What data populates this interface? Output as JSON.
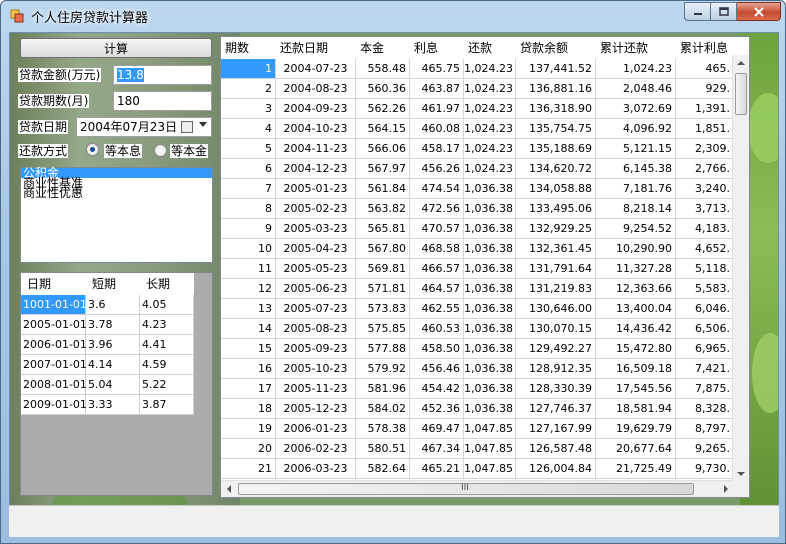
{
  "window": {
    "title": "个人住房贷款计算器"
  },
  "form": {
    "calc_label": "计算",
    "amount_label": "贷款金额(万元)",
    "amount_value": "13.8",
    "term_label": "贷款期数(月)",
    "term_value": "180",
    "date_label": "贷款日期",
    "date_value": "2004年07月23日",
    "method_label": "还款方式",
    "method_options": [
      "等本息",
      "等本金"
    ],
    "method_selected": "等本息"
  },
  "loan_types": [
    "公积金",
    "商业性基准",
    "商业性优惠"
  ],
  "rate_table": {
    "headers": [
      "日期",
      "短期",
      "长期"
    ],
    "rows": [
      [
        "1001-01-01",
        "3.6",
        "4.05"
      ],
      [
        "2005-01-01",
        "3.78",
        "4.23"
      ],
      [
        "2006-01-01",
        "3.96",
        "4.41"
      ],
      [
        "2007-01-01",
        "4.14",
        "4.59"
      ],
      [
        "2008-01-01",
        "5.04",
        "5.22"
      ],
      [
        "2009-01-01",
        "3.33",
        "3.87"
      ]
    ]
  },
  "schedule": {
    "headers": [
      "期数",
      "还款日期",
      "本金",
      "利息",
      "还款",
      "贷款余额",
      "累计还款",
      "累计利息"
    ],
    "rows": [
      [
        "1",
        "2004-07-23",
        "558.48",
        "465.75",
        "1,024.23",
        "137,441.52",
        "1,024.23",
        "465."
      ],
      [
        "2",
        "2004-08-23",
        "560.36",
        "463.87",
        "1,024.23",
        "136,881.16",
        "2,048.46",
        "929."
      ],
      [
        "3",
        "2004-09-23",
        "562.26",
        "461.97",
        "1,024.23",
        "136,318.90",
        "3,072.69",
        "1,391."
      ],
      [
        "4",
        "2004-10-23",
        "564.15",
        "460.08",
        "1,024.23",
        "135,754.75",
        "4,096.92",
        "1,851."
      ],
      [
        "5",
        "2004-11-23",
        "566.06",
        "458.17",
        "1,024.23",
        "135,188.69",
        "5,121.15",
        "2,309."
      ],
      [
        "6",
        "2004-12-23",
        "567.97",
        "456.26",
        "1,024.23",
        "134,620.72",
        "6,145.38",
        "2,766."
      ],
      [
        "7",
        "2005-01-23",
        "561.84",
        "474.54",
        "1,036.38",
        "134,058.88",
        "7,181.76",
        "3,240."
      ],
      [
        "8",
        "2005-02-23",
        "563.82",
        "472.56",
        "1,036.38",
        "133,495.06",
        "8,218.14",
        "3,713."
      ],
      [
        "9",
        "2005-03-23",
        "565.81",
        "470.57",
        "1,036.38",
        "132,929.25",
        "9,254.52",
        "4,183."
      ],
      [
        "10",
        "2005-04-23",
        "567.80",
        "468.58",
        "1,036.38",
        "132,361.45",
        "10,290.90",
        "4,652."
      ],
      [
        "11",
        "2005-05-23",
        "569.81",
        "466.57",
        "1,036.38",
        "131,791.64",
        "11,327.28",
        "5,118."
      ],
      [
        "12",
        "2005-06-23",
        "571.81",
        "464.57",
        "1,036.38",
        "131,219.83",
        "12,363.66",
        "5,583."
      ],
      [
        "13",
        "2005-07-23",
        "573.83",
        "462.55",
        "1,036.38",
        "130,646.00",
        "13,400.04",
        "6,046."
      ],
      [
        "14",
        "2005-08-23",
        "575.85",
        "460.53",
        "1,036.38",
        "130,070.15",
        "14,436.42",
        "6,506."
      ],
      [
        "15",
        "2005-09-23",
        "577.88",
        "458.50",
        "1,036.38",
        "129,492.27",
        "15,472.80",
        "6,965."
      ],
      [
        "16",
        "2005-10-23",
        "579.92",
        "456.46",
        "1,036.38",
        "128,912.35",
        "16,509.18",
        "7,421."
      ],
      [
        "17",
        "2005-11-23",
        "581.96",
        "454.42",
        "1,036.38",
        "128,330.39",
        "17,545.56",
        "7,875."
      ],
      [
        "18",
        "2005-12-23",
        "584.02",
        "452.36",
        "1,036.38",
        "127,746.37",
        "18,581.94",
        "8,328."
      ],
      [
        "19",
        "2006-01-23",
        "578.38",
        "469.47",
        "1,047.85",
        "127,167.99",
        "19,629.79",
        "8,797."
      ],
      [
        "20",
        "2006-02-23",
        "580.51",
        "467.34",
        "1,047.85",
        "126,587.48",
        "20,677.64",
        "9,265."
      ],
      [
        "21",
        "2006-03-23",
        "582.64",
        "465.21",
        "1,047.85",
        "126,004.84",
        "21,725.49",
        "9,730."
      ]
    ]
  },
  "scrollbar": {
    "grip": "III"
  }
}
